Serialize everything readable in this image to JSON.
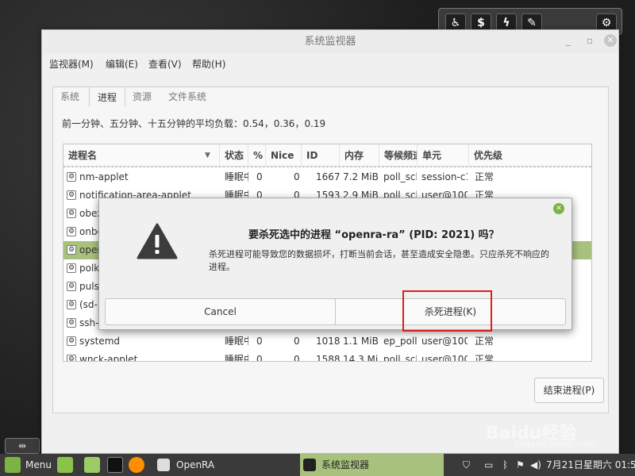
{
  "window": {
    "title": "系统监视器"
  },
  "menubar": [
    "监视器(M)",
    "编辑(E)",
    "查看(V)",
    "帮助(H)"
  ],
  "tabs": [
    "系统",
    "进程",
    "资源",
    "文件系统"
  ],
  "active_tab": "进程",
  "load_average": "前一分钟、五分钟、十五分钟的平均负载：0.54，0.36，0.19",
  "table": {
    "columns": [
      "进程名",
      "状态",
      "%",
      "Nice",
      "ID",
      "内存",
      "等候频道",
      "单元",
      "优先级"
    ],
    "rows": [
      {
        "name": "nm-applet",
        "status": "睡眠中",
        "cpu": "0",
        "nice": "0",
        "id": "1667",
        "mem": "7.2 MiB",
        "wait": "poll_schedule",
        "unit": "session-c1.scope",
        "priority": "正常"
      },
      {
        "name": "notification-area-applet",
        "status": "睡眠中",
        "cpu": "0",
        "nice": "0",
        "id": "1593",
        "mem": "2.9 MiB",
        "wait": "poll_schedule",
        "unit": "user@1000",
        "priority": "正常"
      },
      {
        "name": "obex",
        "status": "",
        "cpu": "",
        "nice": "",
        "id": "",
        "mem": "",
        "wait": "",
        "unit": "",
        "priority": ""
      },
      {
        "name": "onbo",
        "status": "",
        "cpu": "",
        "nice": "",
        "id": "",
        "mem": "",
        "wait": "",
        "unit": "",
        "priority": ""
      },
      {
        "name": "oper",
        "status": "",
        "cpu": "",
        "nice": "",
        "id": "",
        "mem": "",
        "wait": "",
        "unit": "",
        "priority": "",
        "selected": true
      },
      {
        "name": "polk",
        "status": "",
        "cpu": "",
        "nice": "",
        "id": "",
        "mem": "",
        "wait": "",
        "unit": "",
        "priority": ""
      },
      {
        "name": "puls",
        "status": "",
        "cpu": "",
        "nice": "",
        "id": "",
        "mem": "",
        "wait": "",
        "unit": "",
        "priority": ""
      },
      {
        "name": "(sd-p",
        "status": "",
        "cpu": "",
        "nice": "",
        "id": "",
        "mem": "",
        "wait": "",
        "unit": "",
        "priority": ""
      },
      {
        "name": "ssh-",
        "status": "",
        "cpu": "",
        "nice": "",
        "id": "",
        "mem": "",
        "wait": "",
        "unit": "",
        "priority": ""
      },
      {
        "name": "systemd",
        "status": "睡眠中",
        "cpu": "0",
        "nice": "0",
        "id": "1018",
        "mem": "1.1 MiB",
        "wait": "ep_poll",
        "unit": "user@1000",
        "priority": "正常"
      },
      {
        "name": "wnck-applet",
        "status": "睡眠中",
        "cpu": "0",
        "nice": "0",
        "id": "1588",
        "mem": "14.3 MiB",
        "wait": "poll_schedule",
        "unit": "user@1000",
        "priority": "正常"
      }
    ]
  },
  "end_process_button": "结束进程(P)",
  "dialog": {
    "title": "要杀死选中的进程 “openra-ra” (PID: 2021) 吗？",
    "message": "杀死进程可能导致您的数据损坏，打断当前会话，甚至造成安全隐患。只应杀死不响应的进程。",
    "cancel": "Cancel",
    "confirm": "杀死进程(K)"
  },
  "taskbar": {
    "menu": "Menu",
    "openra": "OpenRA",
    "sysmon": "系统监视器",
    "clock": "7月21日星期六 01:55"
  },
  "watermark": {
    "text": "Baidu经验",
    "sub": "jingyan.baidu.com"
  },
  "colors": {
    "selection": "#a8c27d",
    "highlight": "#e21b1b",
    "warning": "#3c3c3c"
  }
}
